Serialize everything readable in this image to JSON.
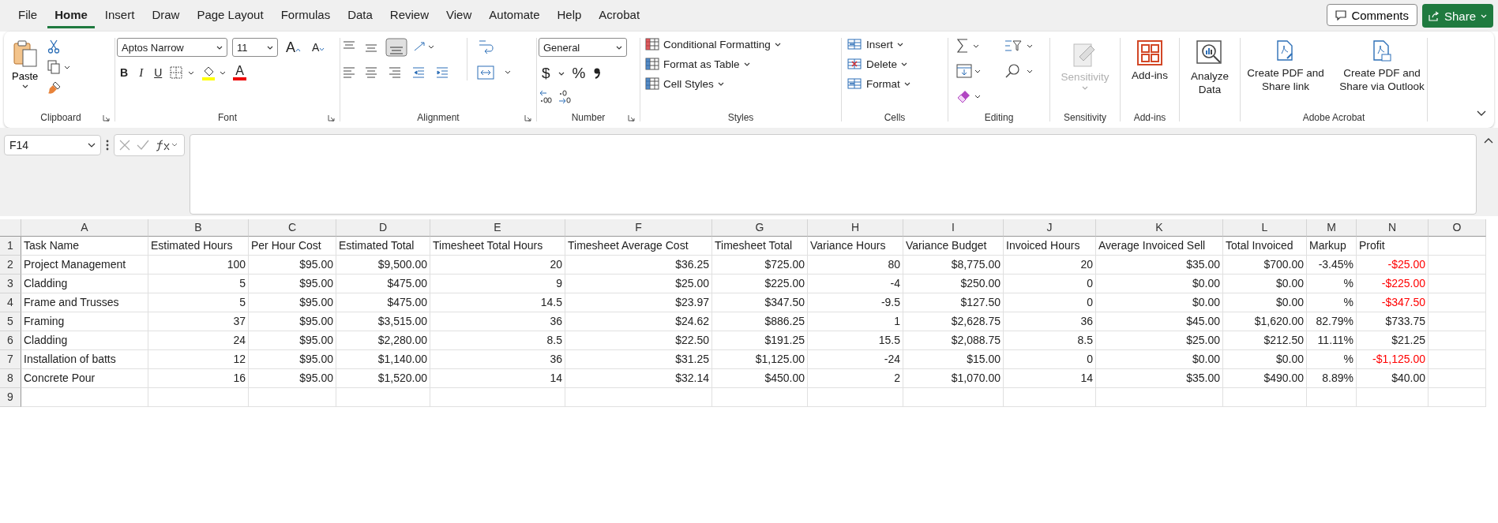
{
  "menu_tabs": [
    {
      "label": "File",
      "selected": false
    },
    {
      "label": "Home",
      "selected": true
    },
    {
      "label": "Insert",
      "selected": false
    },
    {
      "label": "Draw",
      "selected": false
    },
    {
      "label": "Page Layout",
      "selected": false
    },
    {
      "label": "Formulas",
      "selected": false
    },
    {
      "label": "Data",
      "selected": false
    },
    {
      "label": "Review",
      "selected": false
    },
    {
      "label": "View",
      "selected": false
    },
    {
      "label": "Automate",
      "selected": false
    },
    {
      "label": "Help",
      "selected": false
    },
    {
      "label": "Acrobat",
      "selected": false
    }
  ],
  "top_buttons": {
    "comments": "Comments",
    "share": "Share"
  },
  "ribbon": {
    "clipboard": {
      "paste": "Paste",
      "label": "Clipboard"
    },
    "font": {
      "font_name": "Aptos Narrow",
      "font_size": "11",
      "grow": "A",
      "shrink": "A",
      "bold": "B",
      "italic": "I",
      "underline": "U",
      "font_color": "A",
      "label": "Font"
    },
    "alignment": {
      "label": "Alignment"
    },
    "number": {
      "format": "General",
      "currency": "$",
      "percent": "%",
      "label": "Number"
    },
    "styles": {
      "items": [
        "Conditional Formatting",
        "Format as Table",
        "Cell Styles"
      ],
      "label": "Styles"
    },
    "cells": {
      "items": [
        "Insert",
        "Delete",
        "Format"
      ],
      "label": "Cells"
    },
    "editing": {
      "label": "Editing"
    },
    "sensitivity": {
      "button": "Sensitivity",
      "disabled": true,
      "label": "Sensitivity"
    },
    "addins": {
      "button": "Add-ins",
      "label": "Add-ins"
    },
    "analyze": {
      "button": "Analyze Data"
    },
    "acrobat": {
      "buttons": [
        "Create PDF and Share link",
        "Create PDF and Share via Outlook"
      ],
      "label": "Adobe Acrobat"
    }
  },
  "formula_bar": {
    "name_box": "F14"
  },
  "sheet": {
    "columns": [
      "A",
      "B",
      "C",
      "D",
      "E",
      "F",
      "G",
      "H",
      "I",
      "J",
      "K",
      "L",
      "M",
      "N",
      "O"
    ],
    "header_row": {
      "number": "1",
      "cells": [
        "Task Name",
        "Estimated Hours",
        "Per Hour Cost",
        "Estimated Total",
        "Timesheet Total Hours",
        "Timesheet Average Cost",
        "Timesheet Total",
        "Variance Hours",
        "Variance Budget",
        "Invoiced Hours",
        "Average Invoiced Sell",
        "Total Invoiced",
        "Markup",
        "Profit"
      ]
    },
    "rows": [
      {
        "number": "2",
        "cells": [
          "Project Management",
          "100",
          "$95.00",
          "$9,500.00",
          "20",
          "$36.25",
          "$725.00",
          "80",
          "$8,775.00",
          "20",
          "$35.00",
          "$700.00",
          "-3.45%",
          "-$25.00"
        ],
        "negative_profit": true
      },
      {
        "number": "3",
        "cells": [
          "Cladding",
          "5",
          "$95.00",
          "$475.00",
          "9",
          "$25.00",
          "$225.00",
          "-4",
          "$250.00",
          "0",
          "$0.00",
          "$0.00",
          "%",
          "-$225.00"
        ],
        "negative_profit": true
      },
      {
        "number": "4",
        "cells": [
          "Frame and Trusses",
          "5",
          "$95.00",
          "$475.00",
          "14.5",
          "$23.97",
          "$347.50",
          "-9.5",
          "$127.50",
          "0",
          "$0.00",
          "$0.00",
          "%",
          "-$347.50"
        ],
        "negative_profit": true
      },
      {
        "number": "5",
        "cells": [
          "Framing",
          "37",
          "$95.00",
          "$3,515.00",
          "36",
          "$24.62",
          "$886.25",
          "1",
          "$2,628.75",
          "36",
          "$45.00",
          "$1,620.00",
          "82.79%",
          "$733.75"
        ],
        "negative_profit": false
      },
      {
        "number": "6",
        "cells": [
          "Cladding",
          "24",
          "$95.00",
          "$2,280.00",
          "8.5",
          "$22.50",
          "$191.25",
          "15.5",
          "$2,088.75",
          "8.5",
          "$25.00",
          "$212.50",
          "11.11%",
          "$21.25"
        ],
        "negative_profit": false
      },
      {
        "number": "7",
        "cells": [
          "Installation of batts",
          "12",
          "$95.00",
          "$1,140.00",
          "36",
          "$31.25",
          "$1,125.00",
          "-24",
          "$15.00",
          "0",
          "$0.00",
          "$0.00",
          "%",
          "-$1,125.00"
        ],
        "negative_profit": true
      },
      {
        "number": "8",
        "cells": [
          "Concrete Pour",
          "16",
          "$95.00",
          "$1,520.00",
          "14",
          "$32.14",
          "$450.00",
          "2",
          "$1,070.00",
          "14",
          "$35.00",
          "$490.00",
          "8.89%",
          "$40.00"
        ],
        "negative_profit": false
      }
    ],
    "empty_row": {
      "number": "9"
    }
  }
}
